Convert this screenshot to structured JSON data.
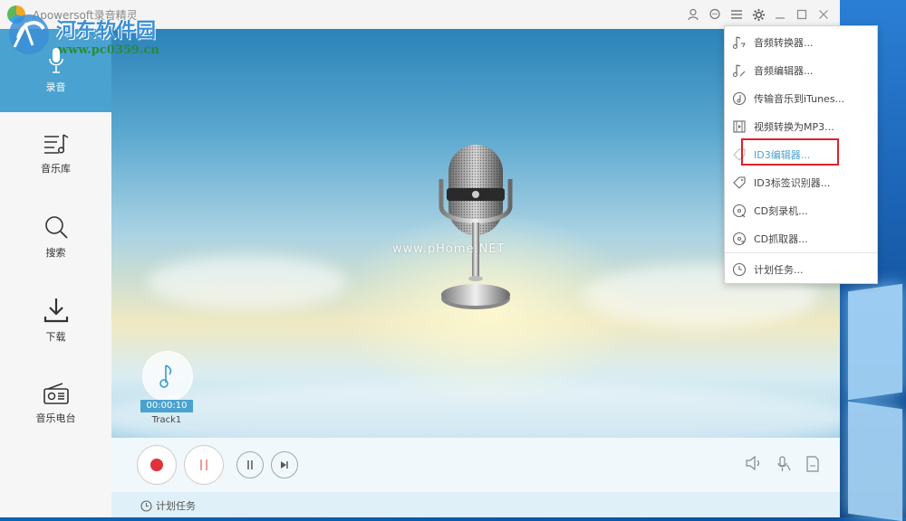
{
  "app": {
    "title": "Apowersoft录音精灵"
  },
  "titlebar": {
    "icons": [
      "user-icon",
      "chat-icon",
      "list-menu-icon",
      "gear-icon",
      "minimize-icon",
      "maximize-icon",
      "close-icon"
    ]
  },
  "sidebar": {
    "items": [
      {
        "label": "录音",
        "icon": "microphone-icon",
        "active": true
      },
      {
        "label": "音乐库",
        "icon": "music-library-icon"
      },
      {
        "label": "搜索",
        "icon": "search-icon"
      },
      {
        "label": "下载",
        "icon": "download-icon"
      },
      {
        "label": "音乐电台",
        "icon": "radio-icon"
      }
    ]
  },
  "stage": {
    "watermark": "www.pHome.NET"
  },
  "track": {
    "time": "00:00:10",
    "name": "Track1"
  },
  "status": {
    "schedule_label": "计划任务"
  },
  "menu": {
    "items": [
      {
        "label": "音频转换器...",
        "icon": "audio-convert-icon"
      },
      {
        "label": "音频编辑器...",
        "icon": "audio-edit-icon"
      },
      {
        "label": "传输音乐到iTunes...",
        "icon": "itunes-icon"
      },
      {
        "label": "视频转换为MP3...",
        "icon": "video-icon"
      },
      {
        "label": "ID3编辑器...",
        "icon": "tag-icon",
        "highlighted": true
      },
      {
        "label": "ID3标签识别器...",
        "icon": "tag-recognize-icon"
      },
      {
        "label": "CD刻录机...",
        "icon": "cd-burn-icon"
      },
      {
        "label": "CD抓取器...",
        "icon": "cd-rip-icon"
      },
      {
        "label": "计划任务...",
        "icon": "clock-icon"
      }
    ]
  },
  "site_watermark": {
    "name": "河东软件园",
    "url": "www.pc0359.cn"
  },
  "colors": {
    "accent": "#4aa2d0",
    "record_red": "#e0323a",
    "highlight_box": "#e0202a"
  }
}
